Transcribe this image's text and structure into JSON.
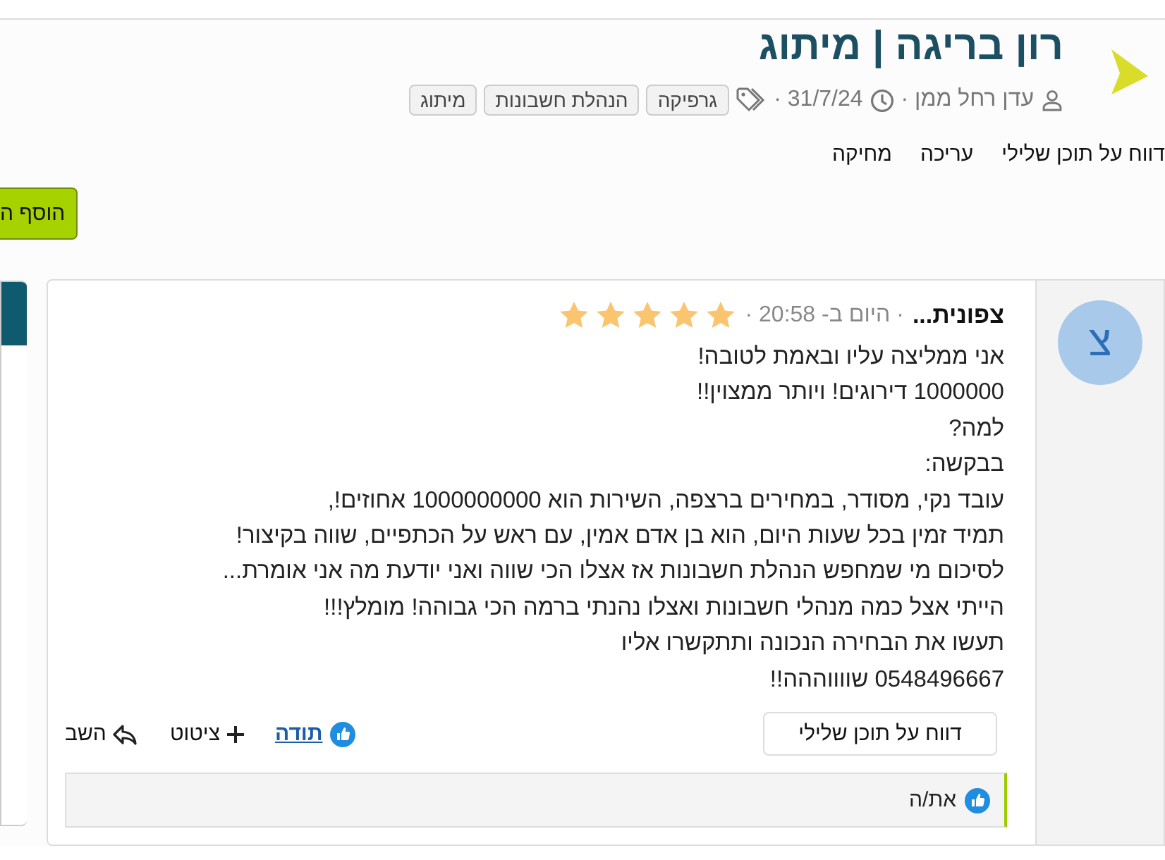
{
  "thread": {
    "title": "רון בריגה | מיתוג",
    "author": "עדן רחל ממן ·",
    "date": "31/7/24 ·",
    "tags": [
      "גרפיקה",
      "הנהלת חשבונות",
      "מיתוג"
    ],
    "actions": [
      "דווח על תוכן שלילי",
      "עריכה",
      "מחיקה"
    ]
  },
  "add_button": "הוסף ה",
  "post": {
    "avatar_letter": "צ",
    "author": "צפונית...",
    "time": "· היום ב- 20:58 ·",
    "stars": 5,
    "lines": [
      "אני ממליצה עליו ובאמת לטובה!",
      "1000000 דירוגים! ויותר ממצוין!!",
      "למה?",
      "בבקשה:",
      "עובד נקי, מסודר, במחירים ברצפה, השירות הוא 1000000000 אחוזים!,",
      "תמיד זמין בכל שעות היום, הוא בן אדם אמין, עם ראש על הכתפיים, שווה בקיצור!",
      "לסיכום מי שמחפש הנהלת חשבונות אז אצלו הכי שווה ואני יודעת מה אני אומרת...",
      "הייתי אצל כמה מנהלי חשבונות ואצלו נהנתי ברמה הכי גבוהה! מומלץ!!!",
      "תעשו את הבחירה הנכונה ותתקשרו אליו",
      "0548496667 שווווההה!!"
    ],
    "report_button": "דווח על תוכן שלילי",
    "actions": [
      {
        "kind": "like",
        "label": "תודה"
      },
      {
        "kind": "quote",
        "label": "ציטוט"
      },
      {
        "kind": "reply",
        "label": "השב"
      }
    ],
    "likes": "את/ה"
  }
}
